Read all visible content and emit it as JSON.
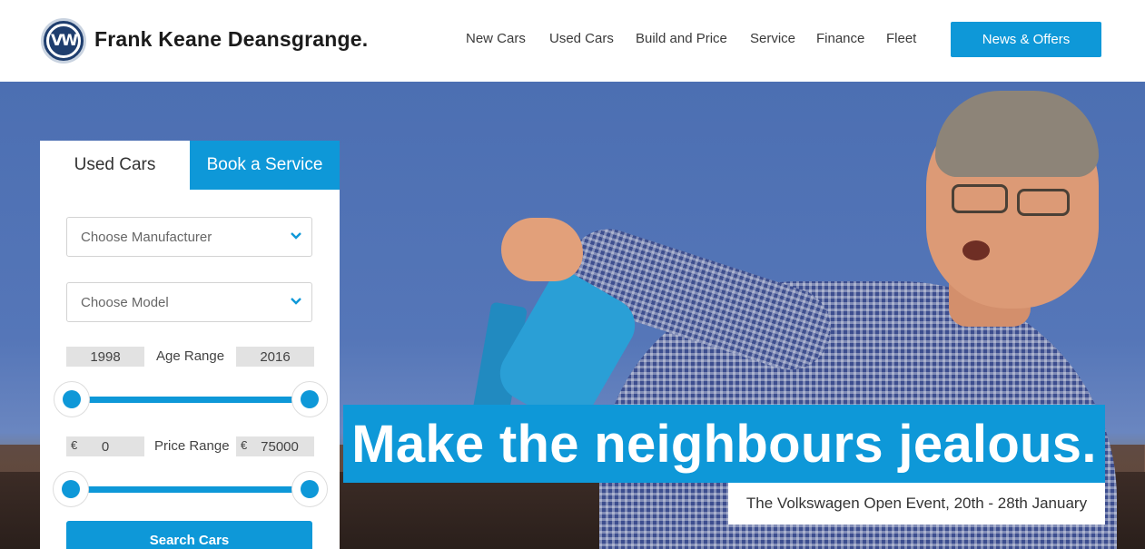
{
  "brand": {
    "name": "Frank Keane Deansgrange.",
    "logo_text": "VW",
    "logo_icon": "volkswagen-logo"
  },
  "nav": {
    "items": [
      "New Cars",
      "Used Cars",
      "Build and Price",
      "Service",
      "Finance",
      "Fleet"
    ],
    "cta_label": "News & Offers"
  },
  "search": {
    "tabs": {
      "used": "Used Cars",
      "book": "Book a Service"
    },
    "manufacturer_placeholder": "Choose Manufacturer",
    "model_placeholder": "Choose Model",
    "age": {
      "label": "Age Range",
      "min": "1998",
      "max": "2016",
      "min_fraction": 0.0,
      "max_fraction": 1.0
    },
    "price": {
      "label": "Price Range",
      "currency": "€",
      "min": "0",
      "max": "75000",
      "min_fraction": 0.0,
      "max_fraction": 1.0
    },
    "button_label": "Search Cars"
  },
  "hero": {
    "headline": "Make the neighbours jealous.",
    "subline": "The Volkswagen Open Event, 20th - 28th January"
  },
  "colors": {
    "accent": "#0e98d8",
    "brand_blue": "#1f3e6e",
    "text": "#333333"
  }
}
